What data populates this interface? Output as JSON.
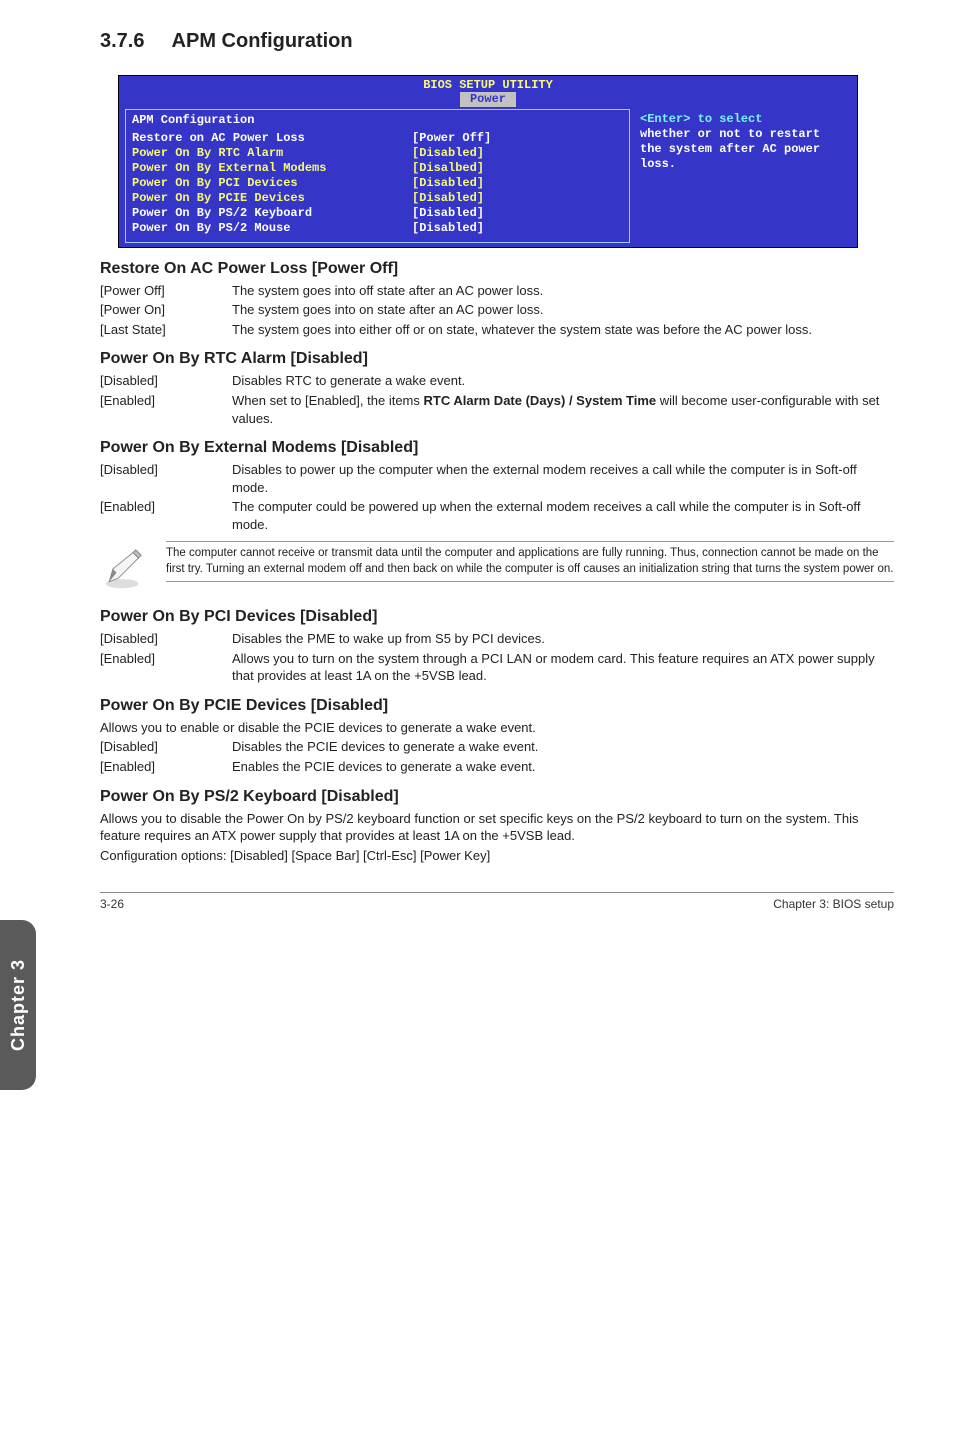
{
  "section": {
    "number": "3.7.6",
    "title": "APM Configuration"
  },
  "bios": {
    "header": "BIOS SETUP UTILITY",
    "tab": "Power",
    "left_title": "APM Configuration",
    "rows": [
      {
        "label": "Restore on AC Power Loss",
        "value": "[Power Off]",
        "highlight": true
      },
      {
        "label": "Power On By RTC Alarm",
        "value": "[Disabled]",
        "highlight": false
      },
      {
        "label": "Power On By External Modems",
        "value": "[Disalbed]",
        "highlight": false
      },
      {
        "label": "Power On By PCI Devices",
        "value": "[Disabled]",
        "highlight": false
      },
      {
        "label": "Power On By PCIE Devices",
        "value": "[Disabled]",
        "highlight": false
      },
      {
        "label": "Power On By PS/2 Keyboard",
        "value": "[Disabled]",
        "highlight": true
      },
      {
        "label": "Power On By PS/2 Mouse",
        "value": "[Disabled]",
        "highlight": true
      }
    ],
    "help1a": "<Enter>",
    "help1b": " to select",
    "help2": "whether or not to restart the system after AC power loss."
  },
  "sub1": {
    "title": "Restore On AC Power Loss [Power Off]",
    "rows": [
      {
        "key": "[Power Off]",
        "val": "The system goes into off state after an AC power loss."
      },
      {
        "key": "[Power On]",
        "val": "The system goes into on state after an AC power loss."
      },
      {
        "key": "[Last State]",
        "val": "The system goes into either off or on state, whatever the system state was before the AC power loss."
      }
    ]
  },
  "sub2": {
    "title": "Power On By RTC Alarm [Disabled]",
    "rows": [
      {
        "key": "[Disabled]",
        "val": "Disables RTC to generate a wake event."
      },
      {
        "key": "[Enabled]",
        "val_pre": "When set to [Enabled], the items ",
        "val_bold": "RTC Alarm Date (Days) / System Time",
        "val_post": " will become user-configurable with set values."
      }
    ]
  },
  "sub3": {
    "title": "Power On By External Modems [Disabled]",
    "rows": [
      {
        "key": "[Disabled]",
        "val": "Disables to power up the computer when the external modem receives a call while the computer is in Soft-off mode."
      },
      {
        "key": "[Enabled]",
        "val": "The computer could be powered up when the external modem receives a call while the computer is in Soft-off mode."
      }
    ]
  },
  "note": "The computer cannot receive or transmit data until the computer and applications are fully running. Thus, connection cannot be made on the first try. Turning an external modem off and then back on while the computer is off causes an initialization string that turns the system power on.",
  "sub4": {
    "title": "Power On By PCI Devices [Disabled]",
    "rows": [
      {
        "key": "[Disabled]",
        "val": "Disables the PME to wake up from S5 by PCI devices."
      },
      {
        "key": "[Enabled]",
        "val": "Allows you to turn on the system through a PCI LAN or modem card. This feature requires an ATX power supply that provides at least 1A on the +5VSB lead."
      }
    ]
  },
  "sub5": {
    "title": "Power On By PCIE Devices [Disabled]",
    "intro": "Allows you to enable or disable the PCIE devices to generate a wake event.",
    "rows": [
      {
        "key": "[Disabled]",
        "val": "Disables the PCIE devices to generate a wake event."
      },
      {
        "key": "[Enabled]",
        "val": "Enables the PCIE devices to generate a wake event."
      }
    ]
  },
  "sub6": {
    "title": "Power On By PS/2 Keyboard [Disabled]",
    "p1": "Allows you to disable the Power On by PS/2 keyboard function or set specific keys on the PS/2 keyboard to turn on the system. This feature requires an ATX power supply that provides at least 1A on the +5VSB lead.",
    "p2": "Configuration options: [Disabled] [Space Bar] [Ctrl-Esc] [Power Key]"
  },
  "sidetab": "Chapter 3",
  "footer": {
    "left": "3-26",
    "right": "Chapter 3: BIOS setup"
  }
}
